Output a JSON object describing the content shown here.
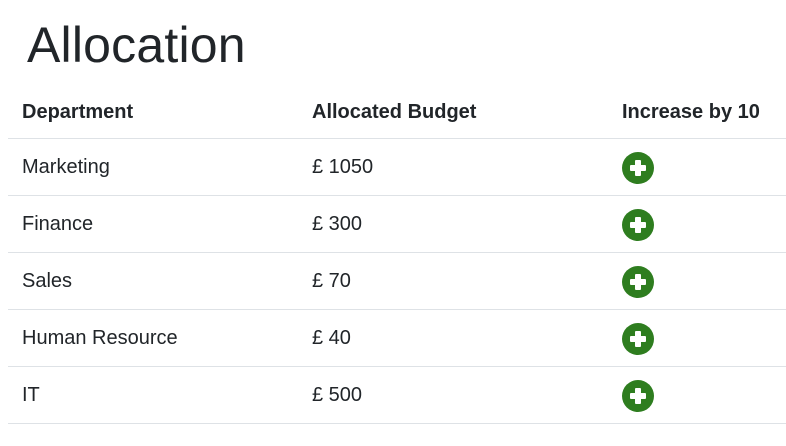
{
  "page": {
    "title": "Allocation"
  },
  "table": {
    "headers": {
      "department": "Department",
      "budget": "Allocated Budget",
      "increase": "Increase by 10"
    },
    "rows": [
      {
        "department": "Marketing",
        "budget": "£ 1050"
      },
      {
        "department": "Finance",
        "budget": "£ 300"
      },
      {
        "department": "Sales",
        "budget": "£ 70"
      },
      {
        "department": "Human Resource",
        "budget": "£ 40"
      },
      {
        "department": "IT",
        "budget": "£ 500"
      }
    ]
  },
  "icons": {
    "increase": "plus-circle-icon"
  },
  "colors": {
    "increase_button": "#2e7d1f",
    "text": "#212529",
    "row_border": "#dee2e6"
  }
}
